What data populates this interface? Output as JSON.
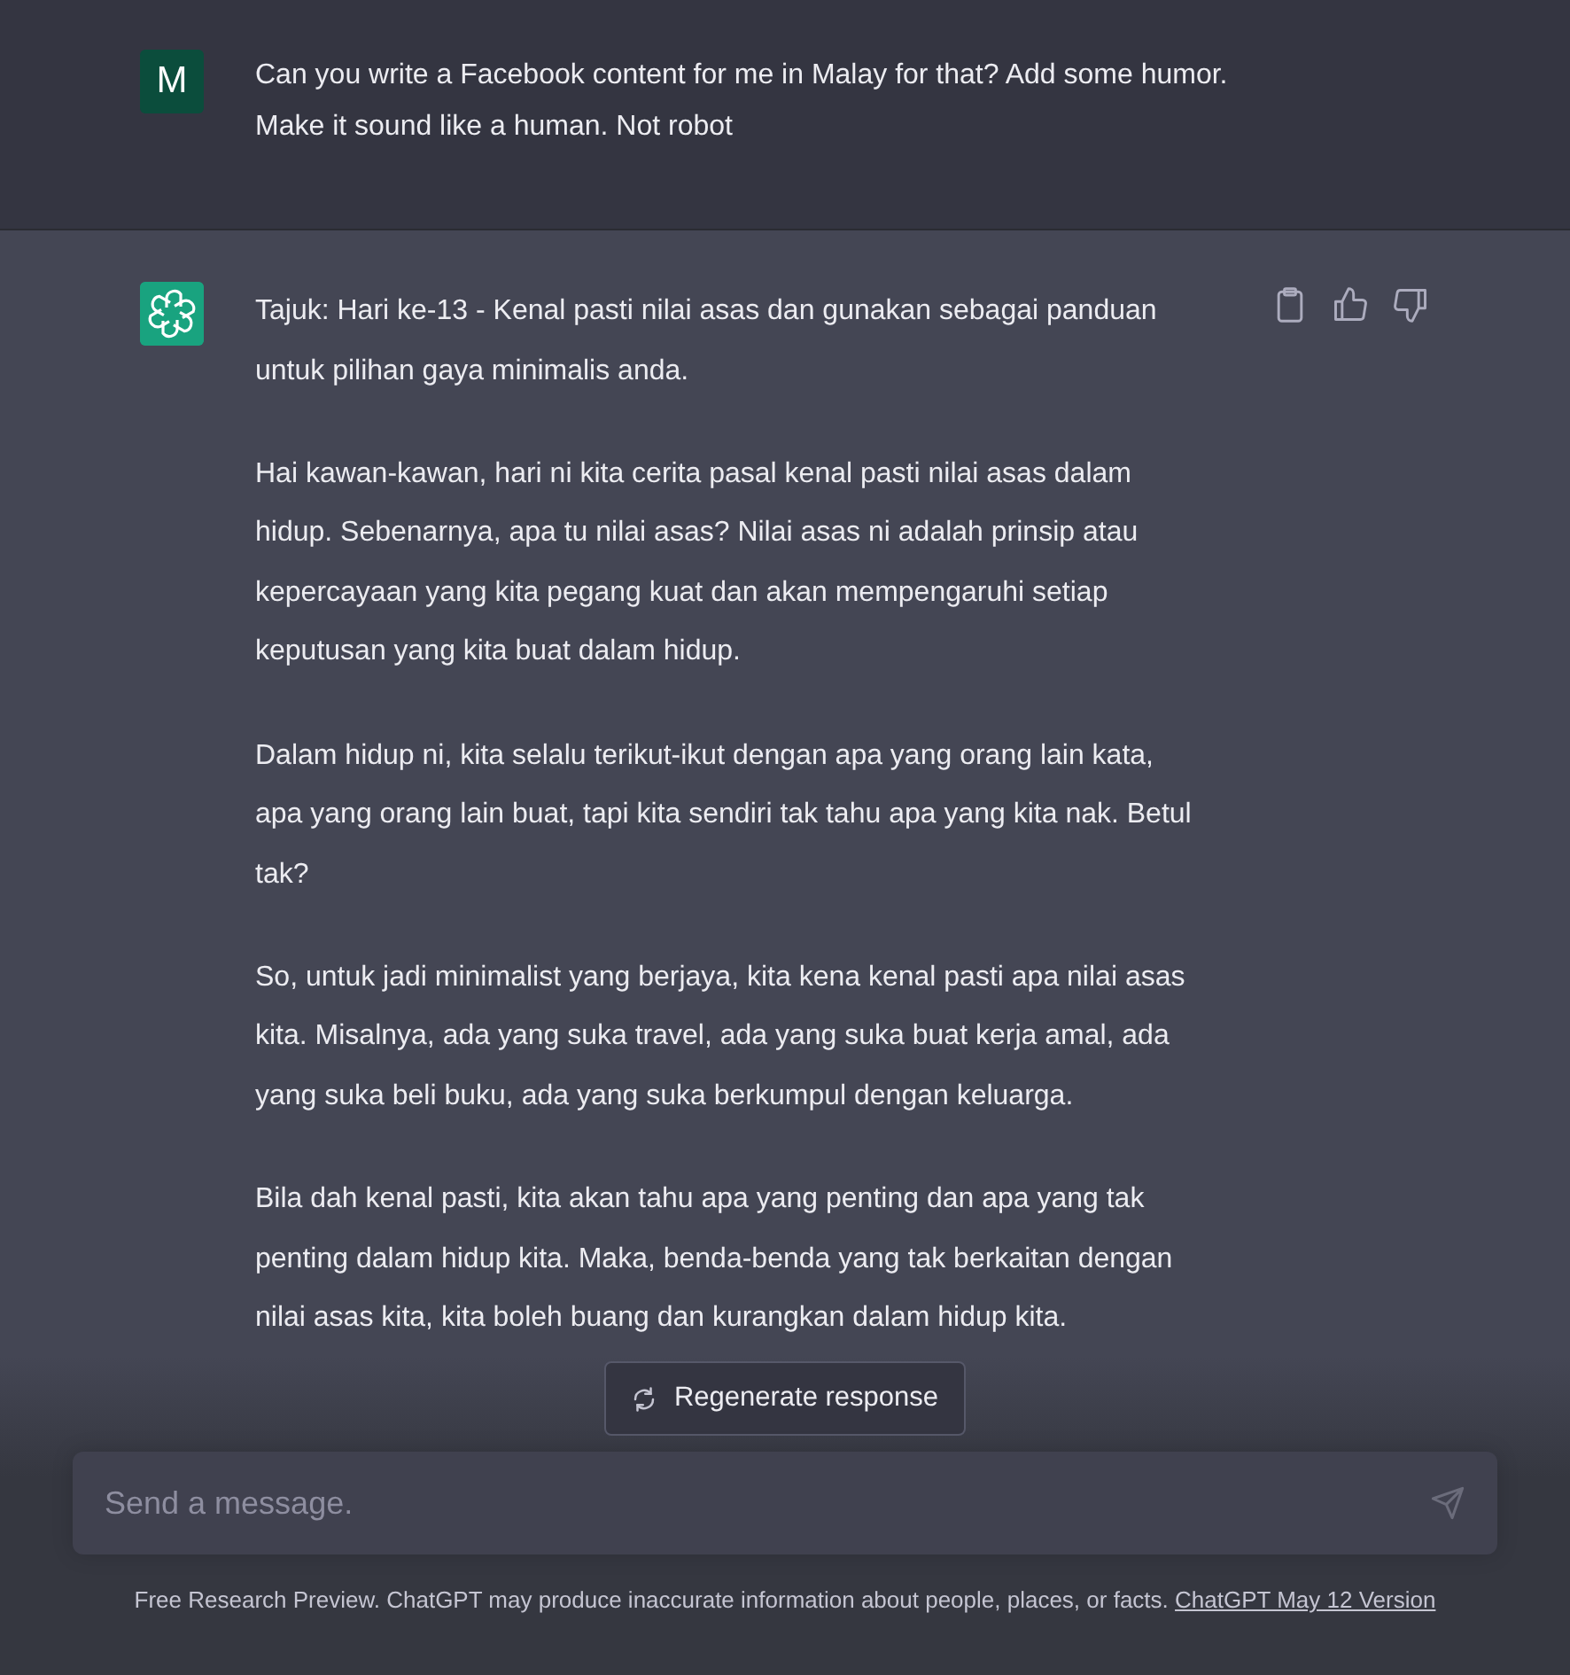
{
  "messages": [
    {
      "kind": "user",
      "avatar": "M",
      "paragraphs": [
        "Can you write a Facebook content for me in Malay for that? Add some humor. Make it sound like a human. Not robot"
      ]
    },
    {
      "kind": "assistant",
      "paragraphs": [
        "Tajuk: Hari ke-13 - Kenal pasti nilai asas dan gunakan sebagai panduan untuk pilihan gaya minimalis anda.",
        "Hai kawan-kawan, hari ni kita cerita pasal kenal pasti nilai asas dalam hidup. Sebenarnya, apa tu nilai asas? Nilai asas ni adalah prinsip atau kepercayaan yang kita pegang kuat dan akan mempengaruhi setiap keputusan yang kita buat dalam hidup.",
        "Dalam hidup ni, kita selalu terikut-ikut dengan apa yang orang lain kata, apa yang orang lain buat, tapi kita sendiri tak tahu apa yang kita nak. Betul tak?",
        "So, untuk jadi minimalist yang berjaya, kita kena kenal pasti apa nilai asas kita. Misalnya, ada yang suka travel, ada yang suka buat kerja amal, ada yang suka beli buku, ada yang suka berkumpul dengan keluarga.",
        "Bila dah kenal pasti, kita akan tahu apa yang penting dan apa yang tak penting dalam hidup kita. Maka, benda-benda yang tak berkaitan dengan nilai asas kita, kita boleh buang dan kurangkan dalam hidup kita."
      ]
    }
  ],
  "regenerate_button": {
    "label": "Regenerate response"
  },
  "composer": {
    "placeholder": "Send a message."
  },
  "footer": {
    "text": "Free Research Preview. ChatGPT may produce inaccurate information about people, places, or facts.",
    "link": "ChatGPT May 12 Version"
  }
}
